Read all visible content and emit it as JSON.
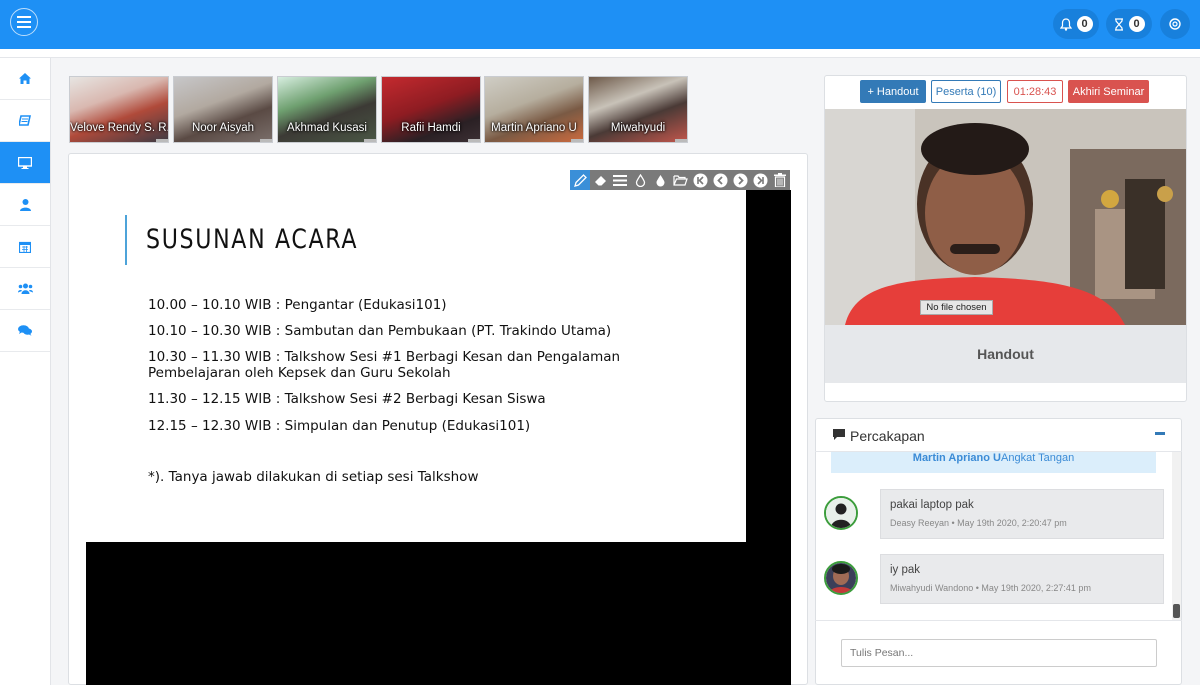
{
  "topbar": {
    "notifications_count": "0",
    "tasks_count": "0"
  },
  "participants": [
    {
      "name": "Velove Rendy S. R."
    },
    {
      "name": "Noor Aisyah"
    },
    {
      "name": "Akhmad Kusasi"
    },
    {
      "name": "Rafii Hamdi"
    },
    {
      "name": "Martin Apriano U"
    },
    {
      "name": "Miwahyudi"
    }
  ],
  "slide": {
    "title": "SUSUNAN ACARA",
    "lines": [
      "10.00 – 10.10 WIB : Pengantar (Edukasi101)",
      "10.10 – 10.30 WIB : Sambutan dan Pembukaan (PT. Trakindo Utama)",
      "10.30 – 11.30 WIB : Talkshow Sesi #1 Berbagi Kesan dan Pengalaman",
      "Pembelajaran oleh Kepsek dan Guru Sekolah",
      "11.30 – 12.15 WIB : Talkshow Sesi #2 Berbagi Kesan Siswa",
      "12.15 – 12.30 WIB : Simpulan dan Penutup (Edukasi101)",
      "*). Tanya jawab dilakukan di setiap sesi Talkshow"
    ]
  },
  "controls": {
    "handout_label": "+ Handout",
    "peserta_label": "Peserta (10)",
    "timer": "01:28:43",
    "end_label": "Akhiri Seminar"
  },
  "video": {
    "file_input_label": "No file chosen"
  },
  "handout_title": "Handout",
  "chat": {
    "title": "Percakapan",
    "notice_name": "Martin Apriano U",
    "notice_text": " Angkat Tangan",
    "messages": [
      {
        "text": "pakai laptop pak",
        "meta": "Deasy Reeyan • May 19th 2020, 2:20:47 pm"
      },
      {
        "text": "iy pak",
        "meta": "Miwahyudi Wandono • May 19th 2020, 2:27:41 pm"
      }
    ],
    "input_placeholder": "Tulis Pesan..."
  },
  "colors": {
    "primary": "#1e90f5",
    "danger": "#d9534f",
    "accent_blue": "#337ab7"
  }
}
